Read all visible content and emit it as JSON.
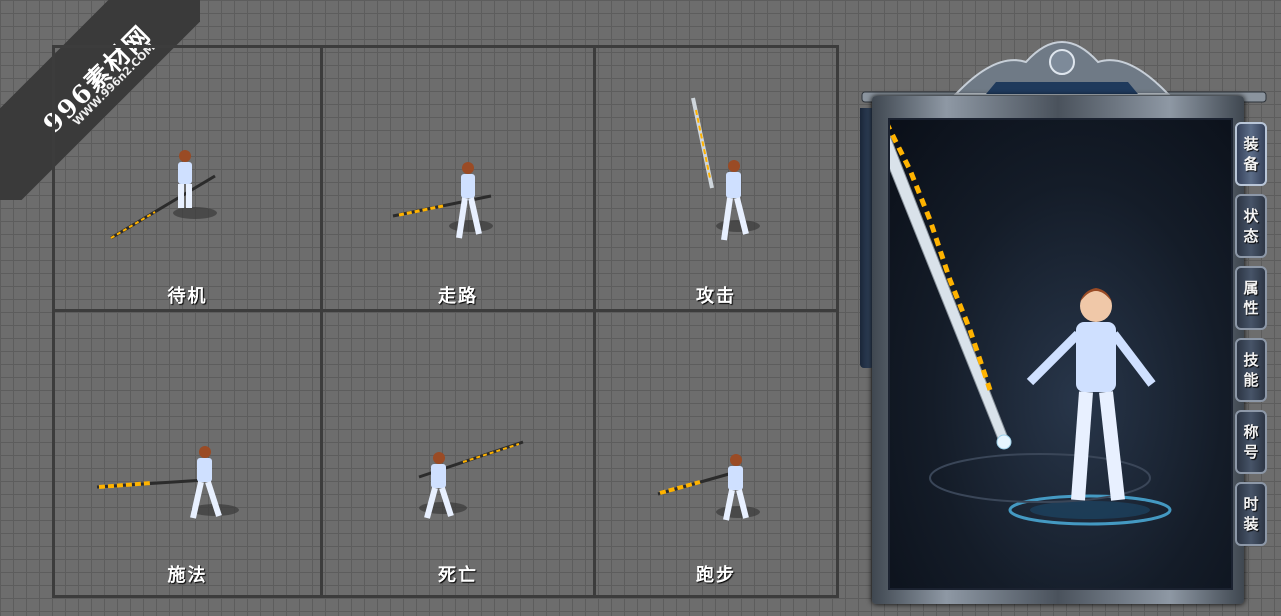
{
  "watermark": {
    "brand": "996素材网",
    "url": "WWW.996n2.COM"
  },
  "animations": [
    {
      "label": "待机"
    },
    {
      "label": "走路"
    },
    {
      "label": "攻击"
    },
    {
      "label": "施法"
    },
    {
      "label": "死亡"
    },
    {
      "label": "跑步"
    }
  ],
  "panel": {
    "tabs": [
      {
        "line1": "装",
        "line2": "备"
      },
      {
        "line1": "状",
        "line2": "态"
      },
      {
        "line1": "属",
        "line2": "性"
      },
      {
        "line1": "技",
        "line2": "能"
      },
      {
        "line1": "称",
        "line2": "号"
      },
      {
        "line1": "时",
        "line2": "装"
      }
    ],
    "active_tab": 0
  },
  "colors": {
    "blade": "#d9e2ea",
    "flame": "#ffb300",
    "suit": "#cfe0ff",
    "hair": "#9a4b25"
  }
}
